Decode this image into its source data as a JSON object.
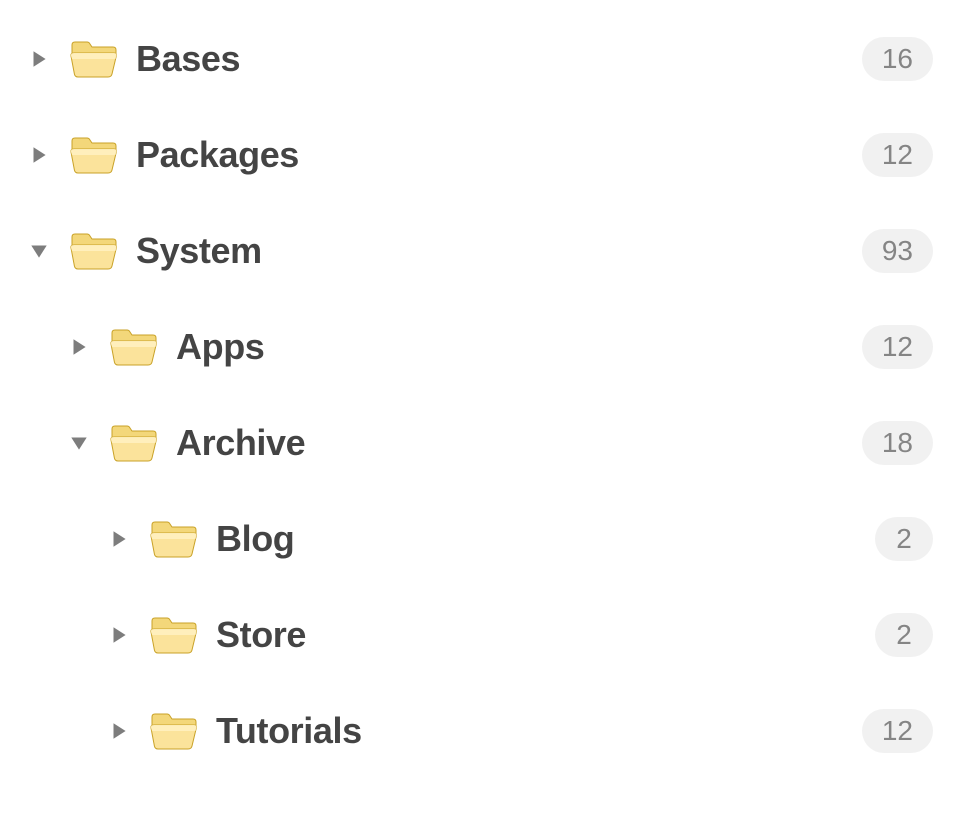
{
  "tree": {
    "items": [
      {
        "label": "Bases",
        "count": 16,
        "expanded": false,
        "indent": 0
      },
      {
        "label": "Packages",
        "count": 12,
        "expanded": false,
        "indent": 0
      },
      {
        "label": "System",
        "count": 93,
        "expanded": true,
        "indent": 0
      },
      {
        "label": "Apps",
        "count": 12,
        "expanded": false,
        "indent": 1
      },
      {
        "label": "Archive",
        "count": 18,
        "expanded": true,
        "indent": 1
      },
      {
        "label": "Blog",
        "count": 2,
        "expanded": false,
        "indent": 2
      },
      {
        "label": "Store",
        "count": 2,
        "expanded": false,
        "indent": 2
      },
      {
        "label": "Tutorials",
        "count": 12,
        "expanded": false,
        "indent": 2
      }
    ]
  },
  "colors": {
    "text": "#444444",
    "badge_bg": "#f1f1f1",
    "badge_text": "#858585",
    "arrow": "#7d7d7d"
  }
}
